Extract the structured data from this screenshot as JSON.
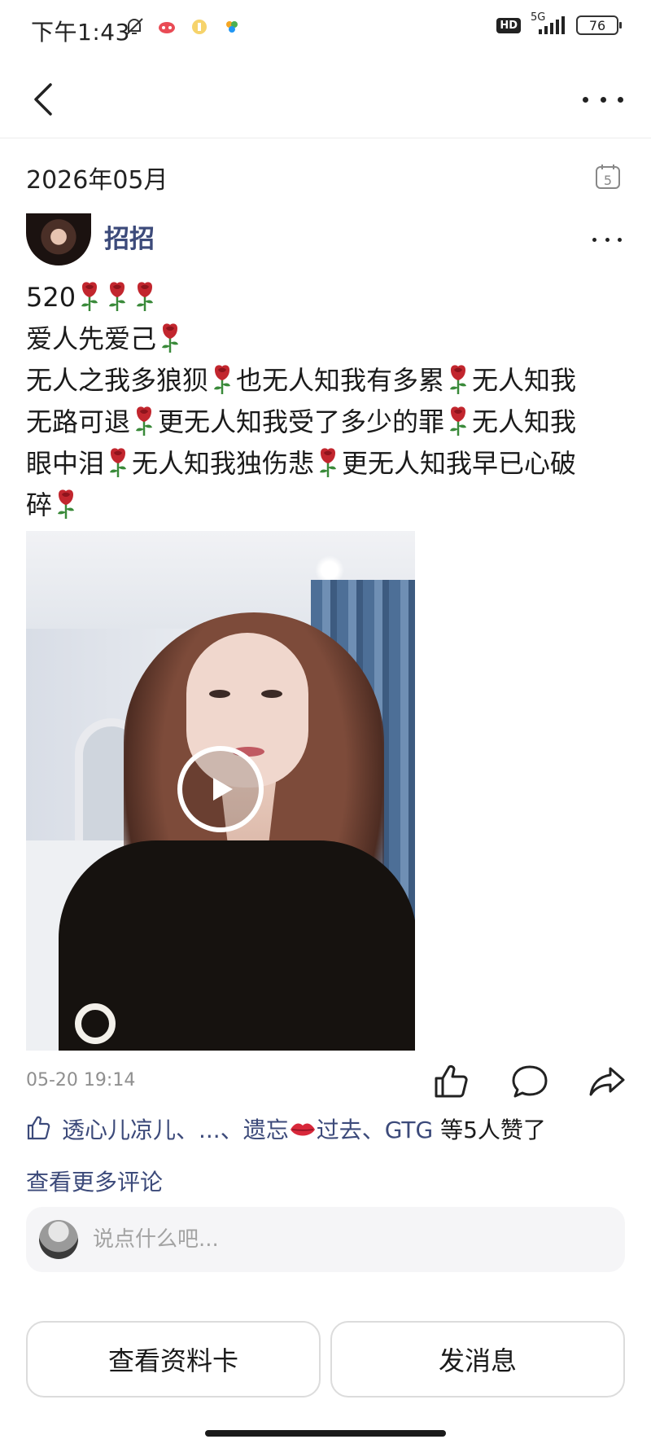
{
  "status_bar": {
    "time": "下午1:43",
    "network": "5G",
    "hd": "HD",
    "battery": "76"
  },
  "nav": {
    "back_icon": "back-arrow-icon",
    "more_icon": "more-horizontal-icon"
  },
  "post": {
    "date": "2026年05月",
    "calendar_day": "5",
    "author_name": "招招",
    "lines": [
      [
        "520",
        "rose",
        "rose",
        "rose"
      ],
      [
        "爱人先爱己",
        "rose"
      ],
      [
        "无人之我多狼狈",
        "rose",
        "也无人知我有多累",
        "rose",
        "无人知我"
      ],
      [
        "无路可退",
        "rose",
        "更无人知我受了多少的罪",
        "rose",
        "无人知我"
      ],
      [
        "眼中泪",
        "rose",
        "无人知我独伤悲",
        "rose",
        "更无人知我早已心破"
      ],
      [
        "碎",
        "rose"
      ]
    ],
    "timestamp": "05-20 19:14"
  },
  "likes": {
    "names": "透心儿凉儿、...、遗忘",
    "names_tail": "过去、GTG",
    "suffix": " 等5人赞了"
  },
  "comments": {
    "more_label": "查看更多评论",
    "input_placeholder": "说点什么吧..."
  },
  "actions": {
    "profile_label": "查看资料卡",
    "message_label": "发消息"
  },
  "colors": {
    "link": "#3c4a7a",
    "rose": "#c2262e"
  }
}
